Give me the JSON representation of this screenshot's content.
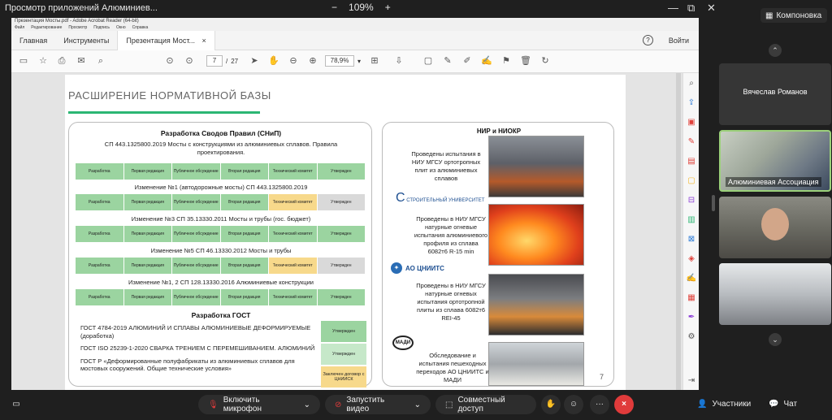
{
  "topbar": {
    "title": "Просмотр приложений Алюминиев...",
    "zoom_minus": "−",
    "zoom_level": "109%",
    "zoom_plus": "+",
    "layout_button": "Компоновка"
  },
  "acrobat": {
    "window_title": "Презентация Мосты.pdf - Adobe Acrobat Reader (64-bit)",
    "menu": [
      "Файл",
      "Редактирование",
      "Просмотр",
      "Подпись",
      "Окно",
      "Справка"
    ],
    "tabs": [
      "Главная",
      "Инструменты",
      "Презентация Мост..."
    ],
    "tab_close": "×",
    "help": "?",
    "signin": "Войти",
    "page_current": "7",
    "page_sep": "/",
    "page_total": "27",
    "zoom": "78,9%"
  },
  "slide": {
    "title": "РАСШИРЕНИЕ НОРМАТИВНОЙ БАЗЫ",
    "left": {
      "heading": "Разработка Сводов Правил (СНиП)",
      "sp1_text": "СП 443.1325800.2019 Мосты с конструкциями из алюминиевых сплавов. Правила проектирования.",
      "change1": "Изменение №1 (автодорожные мосты) СП 443.1325800.2019",
      "change2": "Изменение №3 СП 35.13330.2011 Мосты и трубы (гос. бюджет)",
      "change3": "Изменение №5 СП 46.13330.2012 Мосты и трубы",
      "change4": "Изменение №1, 2 СП 128.13330.2016 Алюминиевые конструкции",
      "stages": [
        "Разработка",
        "Первая редакция",
        "Публичное обсуждение",
        "Вторая редакция",
        "Технический комитет",
        "Утвержден"
      ],
      "gost_heading": "Разработка ГОСТ",
      "gost1": "ГОСТ 4784-2019 АЛЮМИНИЙ И СПЛАВЫ АЛЮМИНИЕВЫЕ ДЕФОРМИРУЕМЫЕ (доработка)",
      "gost2": "ГОСТ ISO 25239-1-2020 СВАРКА ТРЕНИЕМ С ПЕРЕМЕШИВАНИЕМ. АЛЮМИНИЙ",
      "gost3": "ГОСТ Р «Деформированные полуфабрикаты из алюминиевых сплавов для мостовых сооружений. Общие технические условия»",
      "gost_status1": "Утвержден",
      "gost_status2": "Утвержден",
      "gost_status3": "Заключен договор с ЦНИИСК"
    },
    "right": {
      "heading": "НИР и НИОКР",
      "text1": "Проведены испытания в НИУ МГСУ ортотропных плит из алюминиевых сплавов",
      "text2": "Проведены в НИУ МГСУ натурные огневые испытания алюминиевого профиля из сплава 6082т6 R-15 min",
      "text3": "Проведены в НИУ МГСУ натурные огневых испытания ортотропной плиты из сплава 6082т6 REI-45",
      "text4": "Обследование и испытания пешеходных переходов АО ЦНИИТС и МАДИ",
      "logo1": "СТРОИТЕЛЬНЫЙ УНИВЕРСИТЕТ",
      "logo2": "АО ЦНИИТС",
      "logo3": "МАДИ"
    },
    "page_number": "7"
  },
  "participants": [
    {
      "name": "Вячеслав Романов"
    },
    {
      "name": "Алюминиевая Ассоциация"
    },
    {
      "name": ""
    },
    {
      "name": ""
    }
  ],
  "bottombar": {
    "mic": "Включить микрофон",
    "video": "Запустить видео",
    "share": "Совместный доступ",
    "more": "···",
    "hangup": "×",
    "participants": "Участники",
    "chat": "Чат"
  },
  "colors": {
    "green_bar": "#2bb673",
    "stage_green": "#9bd4a0",
    "stage_yellow": "#f7d98b",
    "hangup_red": "#e03b3b"
  }
}
